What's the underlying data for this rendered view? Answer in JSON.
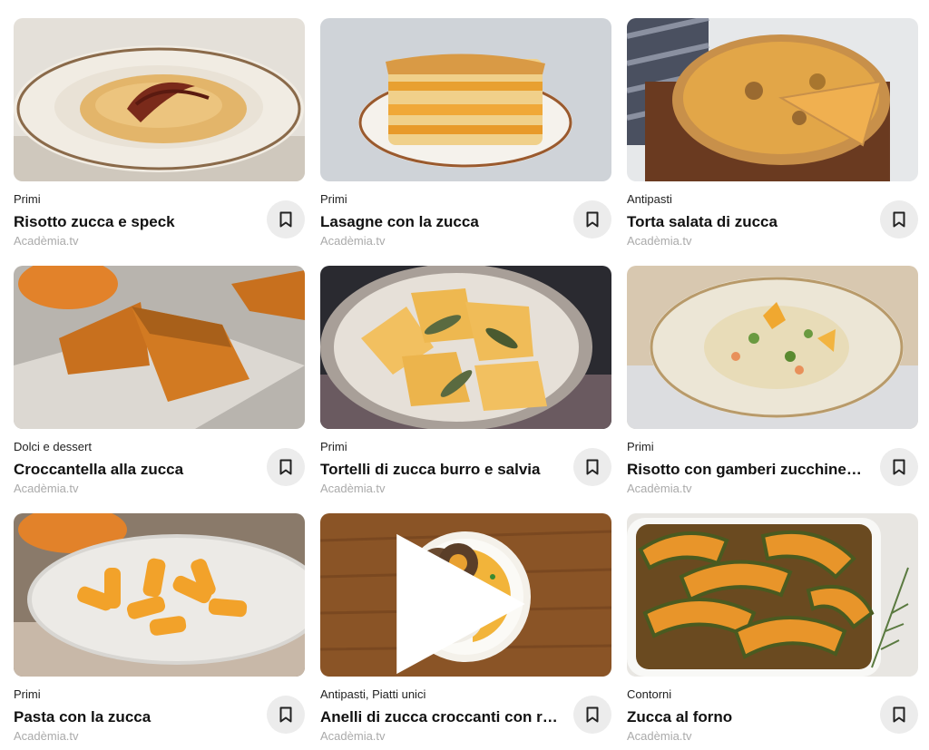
{
  "recipes": [
    {
      "category": "Primi",
      "title": "Risotto zucca e speck",
      "source": "Acadèmia.tv",
      "icon": "bookmark-icon"
    },
    {
      "category": "Primi",
      "title": "Lasagne con la zucca",
      "source": "Acadèmia.tv",
      "icon": "bookmark-icon"
    },
    {
      "category": "Antipasti",
      "title": "Torta salata di zucca",
      "source": "Acadèmia.tv",
      "icon": "bookmark-icon"
    },
    {
      "category": "Dolci e dessert",
      "title": "Croccantella alla zucca",
      "source": "Acadèmia.tv",
      "icon": "bookmark-icon"
    },
    {
      "category": "Primi",
      "title": "Tortelli di zucca burro e salvia",
      "source": "Acadèmia.tv",
      "icon": "bookmark-icon"
    },
    {
      "category": "Primi",
      "title": "Risotto con gamberi zucchine e fiori di zucca",
      "source": "Acadèmia.tv",
      "icon": "bookmark-icon"
    },
    {
      "category": "Primi",
      "title": "Pasta con la zucca",
      "source": "Acadèmia.tv",
      "icon": "bookmark-icon"
    },
    {
      "category": "Antipasti, Piatti unici",
      "title": "Anelli di zucca croccanti con riso basmati",
      "source": "Acadèmia.tv",
      "icon": "bookmark-icon",
      "video_icon": "play-icon"
    },
    {
      "category": "Contorni",
      "title": "Zucca al forno",
      "source": "Acadèmia.tv",
      "icon": "bookmark-icon"
    }
  ],
  "colors": {
    "bookmark_bg": "#ececec",
    "source_text": "#aaaaaa",
    "pumpkin_orange": "#e8892a"
  }
}
